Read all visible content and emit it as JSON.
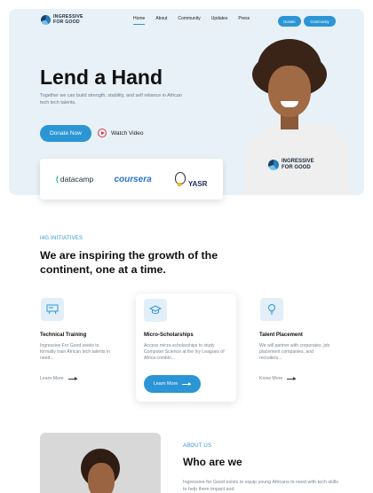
{
  "brand": {
    "line1": "INGRESSIVE",
    "line2": "FOR GOOD"
  },
  "nav": {
    "items": [
      "Home",
      "About",
      "Community",
      "Updates",
      "Press"
    ]
  },
  "header_buttons": {
    "donate": "Donate",
    "community": "Community"
  },
  "hero": {
    "title": "Lend a Hand",
    "subtitle": "Together we can build strength, stability, and self reliance in African tech tech talents.",
    "donate_label": "Donate Now",
    "watch_label": "Watch Video"
  },
  "partners": {
    "datacamp": "datacamp",
    "coursera": "coursera",
    "yasr": "YASR"
  },
  "initiatives": {
    "eyebrow": "I4G INITIATIVES",
    "title": "We are inspiring the growth of the continent, one at a time.",
    "cards": [
      {
        "title": "Technical Training",
        "desc": "Ingressive For Good seeks to formally train African tech talents in need...",
        "link": "Learn More",
        "icon": "training-board-icon"
      },
      {
        "title": "Micro-Scholarships",
        "desc": "Access micro-scholarships to study Computer Science at the Ivy Leagues of Africa combin...",
        "link": "Learn More",
        "icon": "graduation-cap-icon"
      },
      {
        "title": "Talent Placement",
        "desc": "We will partner with corporates, job placement companies, and recruiters...",
        "link": "Know More",
        "icon": "lightbulb-icon"
      }
    ]
  },
  "about": {
    "eyebrow": "ABOUT US",
    "title": "Who are we",
    "text": "Ingressive for Good exists to equip young Africans in need with tech skills to help them impact and"
  },
  "colors": {
    "accent": "#2b95d6",
    "hero_bg": "#e8f1f7"
  }
}
